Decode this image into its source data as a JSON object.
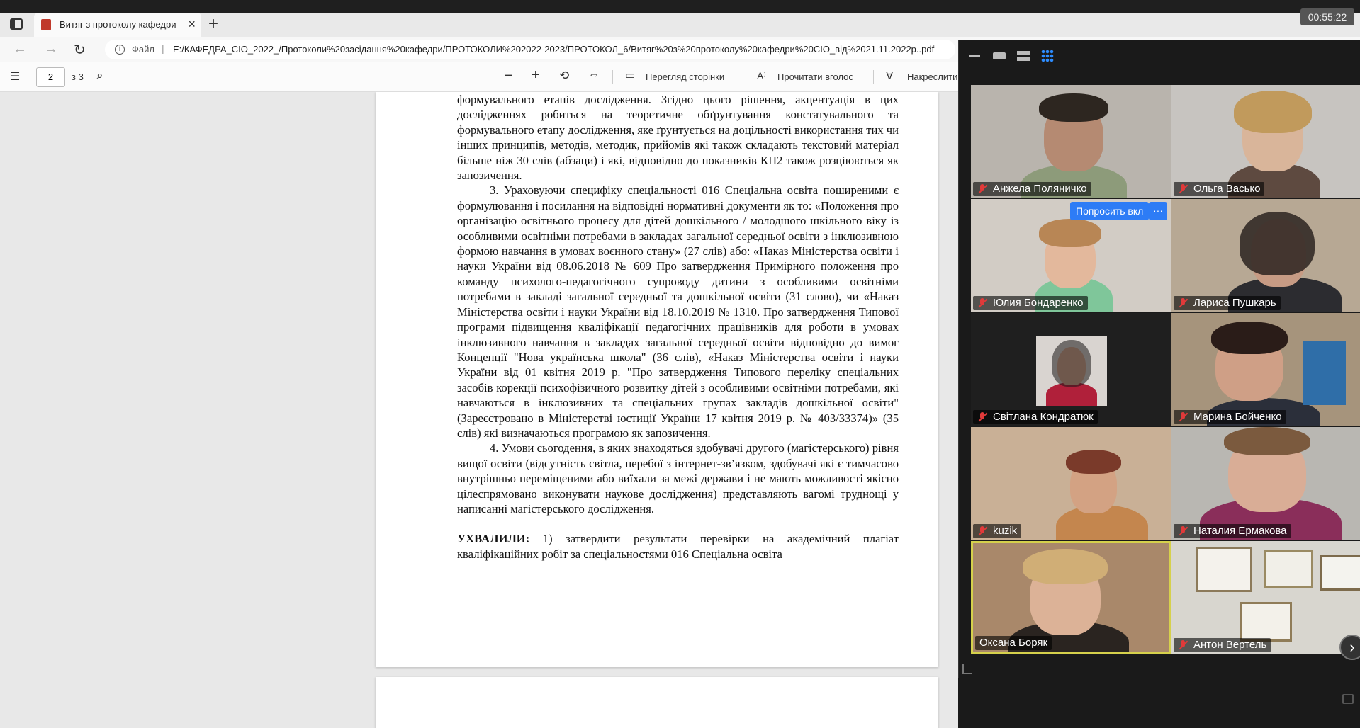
{
  "browser": {
    "tab_title": "Витяг з протоколу кафедри СІО",
    "address_prefix": "Файл",
    "address_url": "E:/КАФЕДРА_СІО_2022_/Протоколи%20засідання%20кафедри/ПРОТОКОЛИ%202022-2023/ПРОТОКОЛ_6/Витяг%20з%20протоколу%20кафедри%20СІО_від%2021.11.2022p..pdf"
  },
  "pdf_toolbar": {
    "page_current": "2",
    "page_total": "з 3",
    "page_view_label": "Перегляд сторінки",
    "read_aloud_label": "Прочитати вголос",
    "draw_label": "Накреслити"
  },
  "document": {
    "para_intro": "формувального етапів дослідження. Згідно цього рішення, акцентуація в цих дослідженнях робиться на теоретичне обґрунтування констатувального та формувального етапу дослідження, яке ґрунтується на доцільності використання тих чи інших принципів, методів, методик, прийомів які також складають текстовий матеріал більше ніж 30 слів (абзаци) і які, відповідно до показників КП2 також розціюються як запозичення.",
    "para_3": "3. Ураховуючи специфіку спеціальності 016 Спеціальна освіта поширеними є формулювання і посилання на відповідні нормативні документи як то: «Положення про організацію освітнього процесу для дітей дошкільного / молодшого шкільного віку із особливими освітніми потребами в закладах загальної середньої освіти з інклюзивною формою навчання в умовах воєнного стану» (27 слів) або: «Наказ Міністерства освіти і науки України від 08.06.2018 № 609 Про затвердження Примірного положення про команду психолого-педагогічного супроводу дитини з особливими освітніми потребами в закладі загальної середньої та дошкільної освіти (31 слово), чи «Наказ Міністерства освіти і науки України від 18.10.2019 № 1310. Про затвердження Типової програми підвищення кваліфікації педагогічних працівників для роботи в умовах інклюзивного навчання в закладах загальної середньої освіти відповідно до вимог Концепції \"Нова українська школа\" (36 слів), «Наказ Міністерства освіти і науки України від 01 квітня 2019 р. \"Про затвердження Типового переліку спеціальних засобів корекції психофізичного розвитку дітей з особливими освітніми потребами, які навчаються в інклюзивних та спеціальних групах закладів дошкільної освіти\" (Зареєстровано в Міністерстві юстиції України 17 квітня 2019 р. № 403/33374)» (35 слів) які визначаються програмою як запозичення.",
    "para_4": "4. Умови сьогодення, в яких знаходяться здобувачі другого (магістерського) рівня вищої освіти (відсутність світла, перебої з інтернет-зв’язком, здобувачі які є тимчасово внутрішньо переміщеними або виїхали за межі держави і не мають можливості якісно цілеспрямовано виконувати наукове дослідження) представляють вагомі труднощі у написанні магістерського дослідження.",
    "resolved_label": "УХВАЛИЛИ:",
    "resolved_text": " 1) затвердити результати перевірки на академічний плагіат кваліфікаційних робіт за спеціальностями 016 Спеціальна освіта"
  },
  "zoom": {
    "timer": "00:55:22",
    "ask_button": "Попросить вкл",
    "more_button": "···",
    "participants": [
      {
        "name": "Анжела Поляничко",
        "muted": true
      },
      {
        "name": "Ольга Васько",
        "muted": true
      },
      {
        "name": "Юлия Бондаренко",
        "muted": true
      },
      {
        "name": "Лариса Пушкарь",
        "muted": true
      },
      {
        "name": "Світлана Кондратюк",
        "muted": true
      },
      {
        "name": "Марина Бойченко",
        "muted": true
      },
      {
        "name": "kuzik",
        "muted": true
      },
      {
        "name": "Наталия Ермакова",
        "muted": true
      },
      {
        "name": "Оксана Боряк",
        "muted": false
      },
      {
        "name": "Антон Вертель",
        "muted": true
      }
    ]
  }
}
